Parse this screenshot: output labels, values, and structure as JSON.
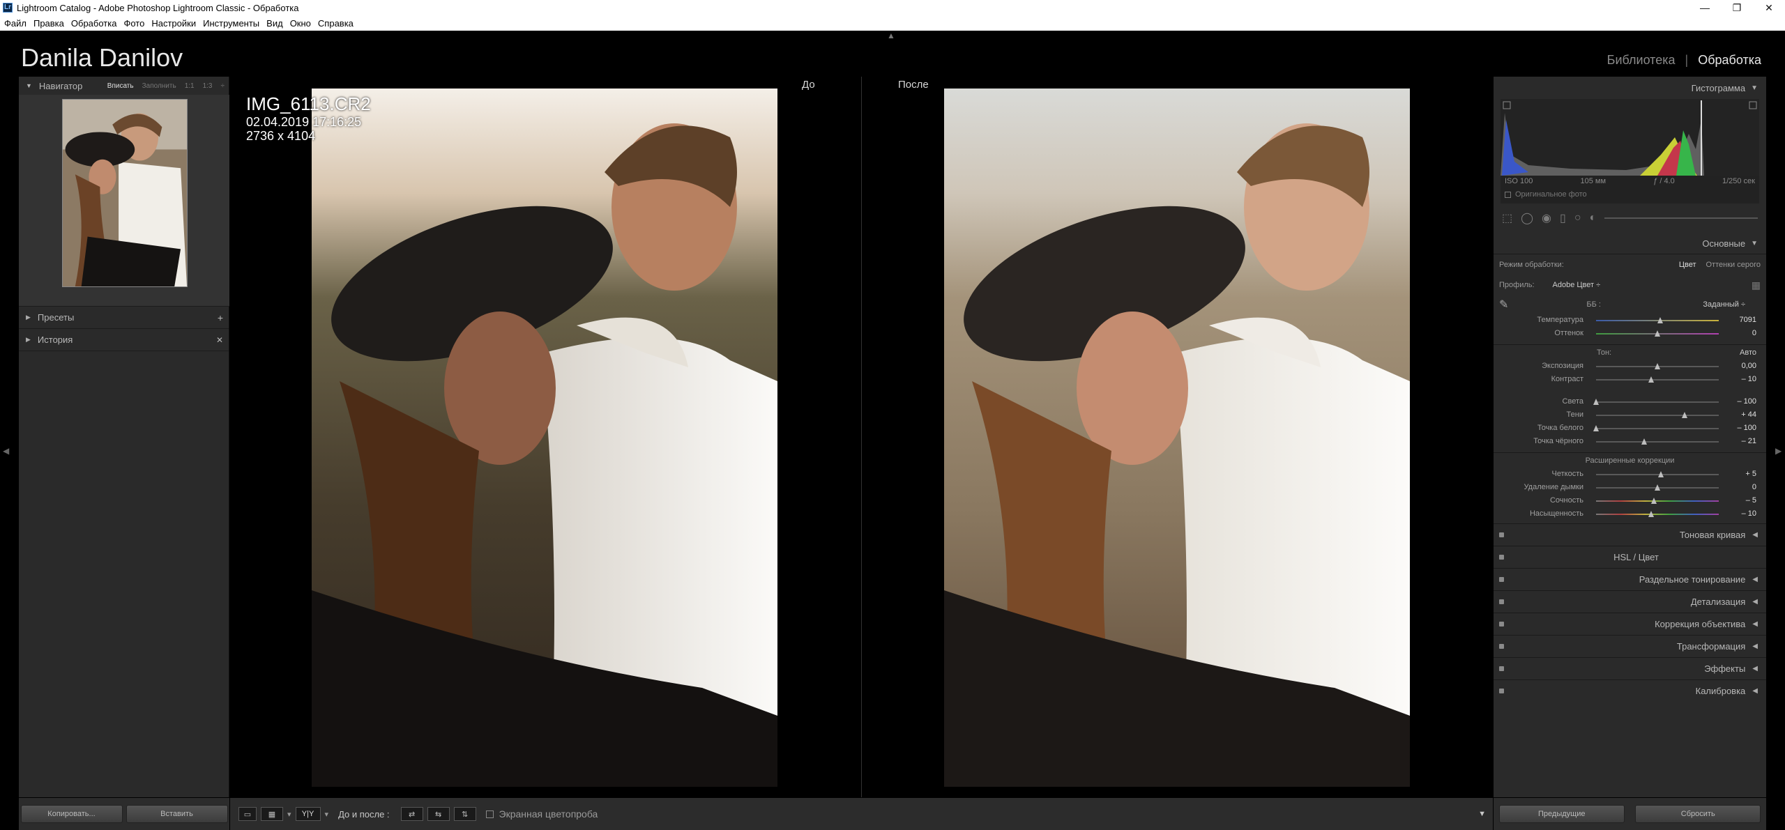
{
  "titlebar": {
    "icon": "Lr",
    "title": "Lightroom Catalog - Adobe Photoshop Lightroom Classic - Обработка",
    "minimize": "—",
    "maximize": "❐",
    "close": "✕"
  },
  "menubar": [
    "Файл",
    "Правка",
    "Обработка",
    "Фото",
    "Настройки",
    "Инструменты",
    "Вид",
    "Окно",
    "Справка"
  ],
  "identity": {
    "plate": "Danila Danilov",
    "modules": {
      "library": "Библиотека",
      "separator": "|",
      "develop": "Обработка"
    }
  },
  "left": {
    "navigator": {
      "title": "Навигатор",
      "options": [
        "Вписать",
        "Заполнить",
        "1:1",
        "1:3"
      ],
      "selected": "Вписать"
    },
    "presets": {
      "title": "Пресеты",
      "action": "+"
    },
    "history": {
      "title": "История",
      "action": "✕"
    },
    "buttons": {
      "copy": "Копировать...",
      "paste": "Вставить"
    }
  },
  "editor": {
    "before_label": "До",
    "after_label": "После",
    "info": {
      "filename": "IMG_6113.CR2",
      "date": "02.04.2019 17:16:25",
      "dimensions": "2736 x 4104"
    }
  },
  "toolbar": {
    "view_mode": "Y|Y",
    "before_after_label": "До и после :",
    "softproof": "Экранная цветопроба",
    "menu": "▼"
  },
  "right": {
    "histogram": {
      "title": "Гистограмма",
      "iso": "ISO 100",
      "focal": "105 мм",
      "aperture": "ƒ / 4.0",
      "shutter": "1/250 сек",
      "original": "Оригинальное фото"
    },
    "basic": {
      "title": "Основные",
      "treatment_label": "Режим обработки:",
      "treatment_color": "Цвет",
      "treatment_bw": "Оттенки серого",
      "profile_label": "Профиль:",
      "profile_value": "Adobe Цвет ÷",
      "wb_label": "ББ :",
      "wb_value": "Заданный ÷",
      "tone_label": "Тон:",
      "tone_auto": "Авто",
      "presence_label": "Расширенные коррекции",
      "wb_sliders": [
        {
          "name": "Температура",
          "value": "7091",
          "pos": 0.52
        },
        {
          "name": "Оттенок",
          "value": "0",
          "pos": 0.5
        }
      ],
      "tone_sliders": [
        {
          "name": "Экспозиция",
          "value": "0,00",
          "pos": 0.5
        },
        {
          "name": "Контраст",
          "value": "– 10",
          "pos": 0.45
        }
      ],
      "tone_sliders2": [
        {
          "name": "Света",
          "value": "– 100",
          "pos": 0.0
        },
        {
          "name": "Тени",
          "value": "+ 44",
          "pos": 0.72
        },
        {
          "name": "Точка белого",
          "value": "– 100",
          "pos": 0.0
        },
        {
          "name": "Точка чёрного",
          "value": "– 21",
          "pos": 0.39
        }
      ],
      "presence_sliders": [
        {
          "name": "Четкость",
          "value": "+ 5",
          "pos": 0.53
        },
        {
          "name": "Удаление дымки",
          "value": "0",
          "pos": 0.5
        },
        {
          "name": "Сочность",
          "value": "– 5",
          "pos": 0.47
        },
        {
          "name": "Насыщенность",
          "value": "– 10",
          "pos": 0.45
        }
      ]
    },
    "sections": [
      "Тоновая кривая",
      "HSL / Цвет",
      "Раздельное тонирование",
      "Детализация",
      "Коррекция объектива",
      "Трансформация",
      "Эффекты",
      "Калибровка"
    ],
    "buttons": {
      "previous": "Предыдущие",
      "reset": "Сбросить"
    }
  }
}
